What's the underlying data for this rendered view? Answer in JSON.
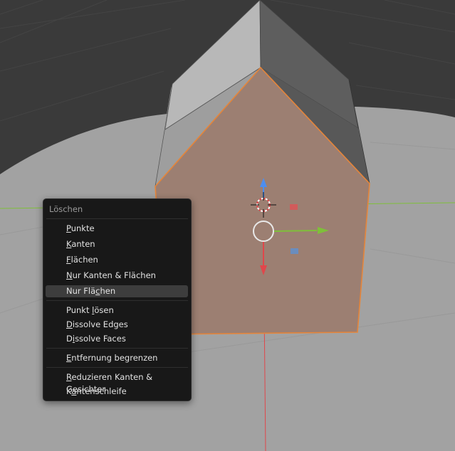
{
  "menu": {
    "title": "Löschen",
    "items": [
      {
        "pre": "",
        "ul": "P",
        "post": "unkte",
        "active": false
      },
      {
        "pre": "",
        "ul": "K",
        "post": "anten",
        "active": false
      },
      {
        "pre": "",
        "ul": "F",
        "post": "lächen",
        "active": false
      },
      {
        "pre": "",
        "ul": "N",
        "post": "ur Kanten & Flächen",
        "active": false
      },
      {
        "pre": "Nur Flä",
        "ul": "c",
        "post": "hen",
        "active": true
      },
      {
        "pre": "Punkt ",
        "ul": "l",
        "post": "ösen",
        "active": false
      },
      {
        "pre": "",
        "ul": "D",
        "post": "issolve Edges",
        "active": false
      },
      {
        "pre": "D",
        "ul": "i",
        "post": "ssolve Faces",
        "active": false
      },
      {
        "pre": "",
        "ul": "E",
        "post": "ntfernung begrenzen",
        "active": false
      },
      {
        "pre": "",
        "ul": "R",
        "post": "eduzieren Kanten & Gesichter",
        "active": false
      },
      {
        "pre": "K",
        "ul": "a",
        "post": "ntenschleife",
        "active": false
      }
    ]
  },
  "colors": {
    "selection": "#e5853a",
    "face": "#9c7f72",
    "axis_x": "#e0474b",
    "axis_y": "#7fbf3a",
    "axis_z": "#4d8ef0"
  }
}
